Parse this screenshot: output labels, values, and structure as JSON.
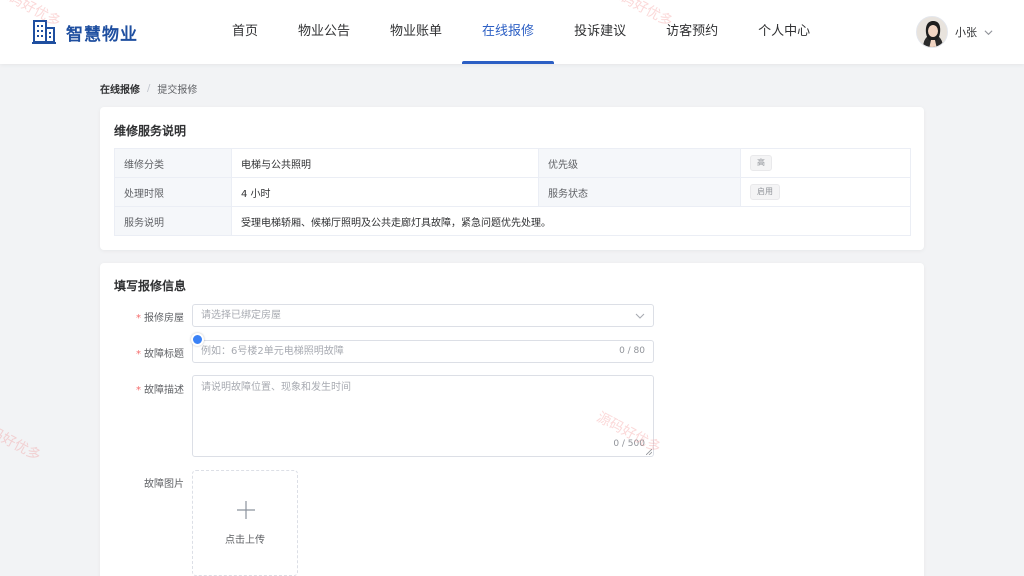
{
  "header": {
    "brand_name": "智慧物业",
    "nav": [
      {
        "label": "首页"
      },
      {
        "label": "物业公告"
      },
      {
        "label": "物业账单"
      },
      {
        "label": "在线报修",
        "active": true
      },
      {
        "label": "投诉建议"
      },
      {
        "label": "访客预约"
      },
      {
        "label": "个人中心"
      }
    ],
    "user_name": "小张"
  },
  "breadcrumb": {
    "root": "在线报修",
    "separator": "/",
    "current": "提交报修"
  },
  "service_info": {
    "title": "维修服务说明",
    "rows": [
      {
        "label1": "维修分类",
        "value1": "电梯与公共照明",
        "label2": "优先级",
        "tag2": "高"
      },
      {
        "label1": "处理时限",
        "value1": "4 小时",
        "label2": "服务状态",
        "tag2": "启用"
      },
      {
        "label1": "服务说明",
        "value1": "受理电梯轿厢、候梯厅照明及公共走廊灯具故障，紧急问题优先处理。"
      }
    ]
  },
  "repair_form": {
    "title": "填写报修信息",
    "required_mark": "*",
    "house": {
      "label": "报修房屋",
      "placeholder": "请选择已绑定房屋"
    },
    "fault_title": {
      "label": "故障标题",
      "placeholder": "例如：6号楼2单元电梯照明故障",
      "count": "0 / 80"
    },
    "fault_desc": {
      "label": "故障描述",
      "placeholder": "请说明故障位置、现象和发生时间",
      "count": "0 / 500"
    },
    "fault_images": {
      "label": "故障图片",
      "upload_text": "点击上传"
    }
  },
  "watermark_text": "源码好优多",
  "colors": {
    "primary": "#2c5fc4",
    "brand": "#1f4fa0",
    "required": "#f56c6c"
  }
}
